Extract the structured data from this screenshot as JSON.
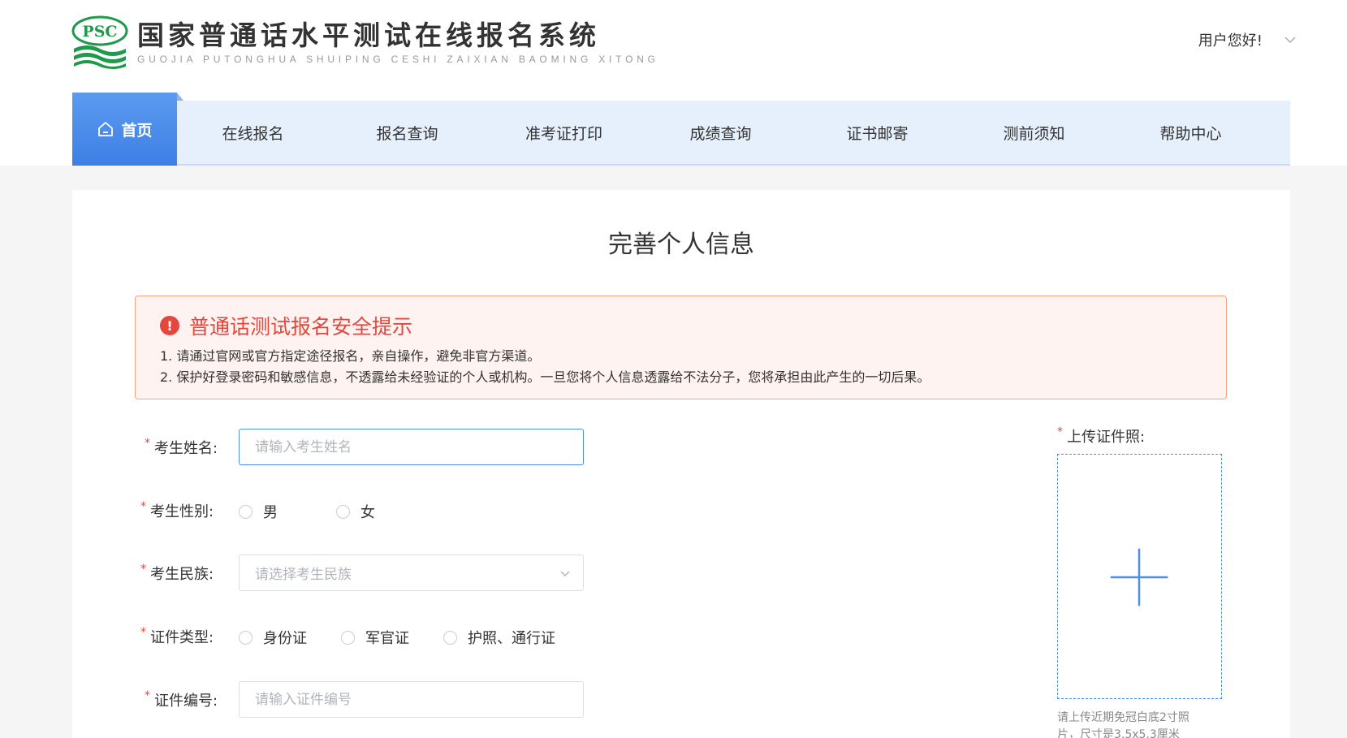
{
  "header": {
    "logo_badge": "PSC",
    "title": "国家普通话水平测试在线报名系统",
    "subtitle": "GUOJIA PUTONGHUA SHUIPING CESHI ZAIXIAN BAOMING XITONG",
    "greeting": "用户您好!"
  },
  "nav": {
    "items": [
      {
        "label": "首页",
        "active": true,
        "icon": "home-icon"
      },
      {
        "label": "在线报名"
      },
      {
        "label": "报名查询"
      },
      {
        "label": "准考证打印"
      },
      {
        "label": "成绩查询"
      },
      {
        "label": "证书邮寄"
      },
      {
        "label": "测前须知"
      },
      {
        "label": "帮助中心"
      }
    ]
  },
  "page": {
    "title": "完善个人信息"
  },
  "alert": {
    "icon": "exclamation-icon",
    "title": "普通话测试报名安全提示",
    "line1": "1. 请通过官网或官方指定途径报名，亲自操作，避免非官方渠道。",
    "line2": "2. 保护好登录密码和敏感信息，不透露给未经验证的个人或机构。一旦您将个人信息透露给不法分子，您将承担由此产生的一切后果。"
  },
  "form": {
    "required_mark": "*",
    "name": {
      "label": "考生姓名:",
      "placeholder": "请输入考生姓名",
      "value": ""
    },
    "gender": {
      "label": "考生性别:",
      "options": [
        "男",
        "女"
      ]
    },
    "ethnicity": {
      "label": "考生民族:",
      "placeholder": "请选择考生民族"
    },
    "id_type": {
      "label": "证件类型:",
      "options": [
        "身份证",
        "军官证",
        "护照、通行证"
      ]
    },
    "id_number": {
      "label": "证件编号:",
      "placeholder": "请输入证件编号",
      "value": ""
    }
  },
  "upload": {
    "label": "上传证件照:",
    "hint": "请上传近期免冠白底2寸照片，尺寸是3.5x5.3厘米"
  },
  "colors": {
    "accent": "#4c8fe8",
    "nav_bg": "#e6f0fc",
    "alert_text": "#e5473d",
    "alert_border": "#f5a37c",
    "logo_green": "#1e9a4a"
  }
}
